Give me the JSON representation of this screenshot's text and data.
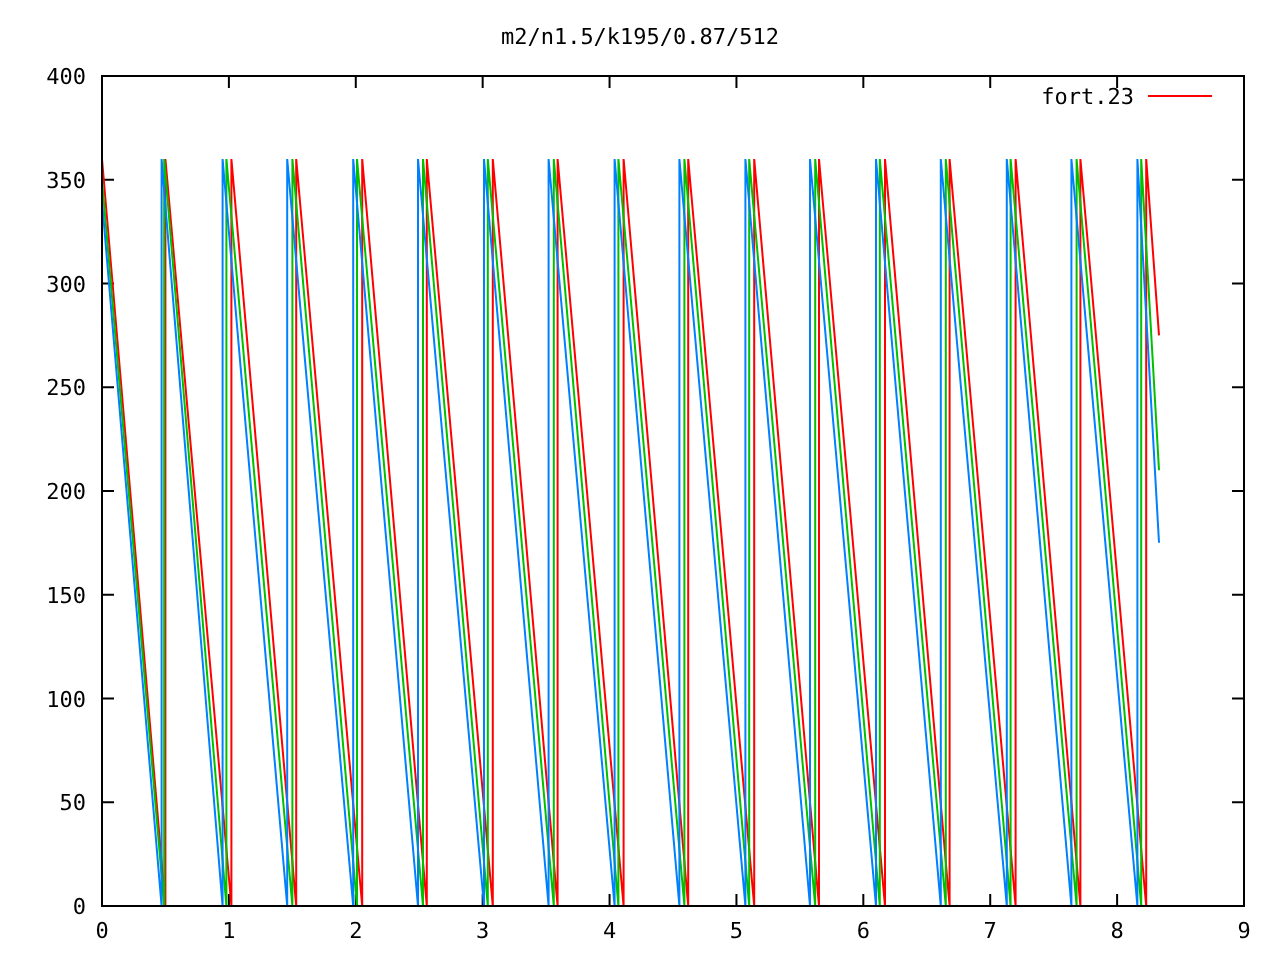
{
  "chart_data": {
    "type": "line",
    "title": "m2/n1.5/k195/0.87/512",
    "xlim": [
      0,
      9
    ],
    "ylim": [
      0,
      400
    ],
    "xticks": [
      0,
      1,
      2,
      3,
      4,
      5,
      6,
      7,
      8,
      9
    ],
    "yticks": [
      0,
      50,
      100,
      150,
      200,
      250,
      300,
      350,
      400
    ],
    "series": [
      {
        "name": "fort.23",
        "color": "#ff0000",
        "x": [
          0,
          0.5,
          0.5,
          1.02,
          1.02,
          1.53,
          1.53,
          2.05,
          2.05,
          2.56,
          2.56,
          3.08,
          3.08,
          3.59,
          3.59,
          4.11,
          4.11,
          4.62,
          4.62,
          5.14,
          5.14,
          5.65,
          5.65,
          6.17,
          6.17,
          6.68,
          6.68,
          7.2,
          7.2,
          7.71,
          7.71,
          8.23,
          8.23,
          8.33
        ],
        "values": [
          360,
          0,
          360,
          0,
          360,
          0,
          360,
          0,
          360,
          0,
          360,
          0,
          360,
          0,
          360,
          0,
          360,
          0,
          360,
          0,
          360,
          0,
          360,
          0,
          360,
          0,
          360,
          0,
          360,
          0,
          360,
          0,
          360,
          275
        ]
      },
      {
        "color": "#00c000",
        "x": [
          0,
          0.49,
          0.49,
          0.98,
          0.98,
          1.5,
          1.5,
          2.01,
          2.01,
          2.53,
          2.53,
          3.04,
          3.04,
          3.56,
          3.56,
          4.07,
          4.07,
          4.59,
          4.59,
          5.1,
          5.1,
          5.62,
          5.62,
          6.13,
          6.13,
          6.65,
          6.65,
          7.16,
          7.16,
          7.68,
          7.68,
          8.19,
          8.19,
          8.33
        ],
        "values": [
          350,
          0,
          360,
          0,
          360,
          0,
          360,
          0,
          360,
          0,
          360,
          0,
          360,
          0,
          360,
          0,
          360,
          0,
          360,
          0,
          360,
          0,
          360,
          0,
          360,
          0,
          360,
          0,
          360,
          0,
          360,
          0,
          360,
          210
        ]
      },
      {
        "color": "#0080ff",
        "x": [
          0,
          0.47,
          0.47,
          0.95,
          0.95,
          1.46,
          1.46,
          1.98,
          1.98,
          2.49,
          2.49,
          3.01,
          3.01,
          3.52,
          3.52,
          4.04,
          4.04,
          4.55,
          4.55,
          5.07,
          5.07,
          5.58,
          5.58,
          6.1,
          6.1,
          6.61,
          6.61,
          7.13,
          7.13,
          7.64,
          7.64,
          8.16,
          8.16,
          8.33
        ],
        "values": [
          340,
          0,
          360,
          0,
          360,
          0,
          360,
          0,
          360,
          0,
          360,
          0,
          360,
          0,
          360,
          0,
          360,
          0,
          360,
          0,
          360,
          0,
          360,
          0,
          360,
          0,
          360,
          0,
          360,
          0,
          360,
          0,
          360,
          175
        ]
      }
    ]
  }
}
